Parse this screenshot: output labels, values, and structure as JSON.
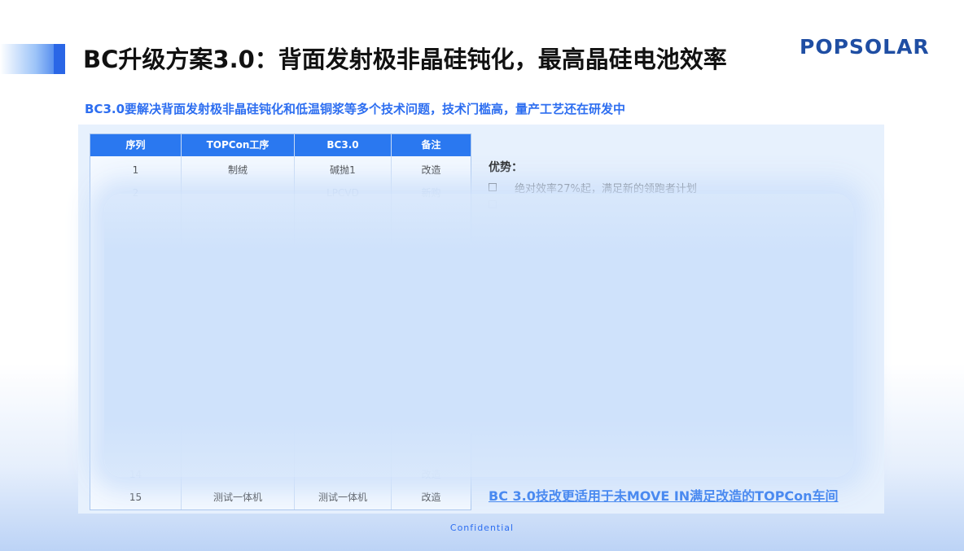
{
  "title": "BC升级方案3.0：背面发射极非晶硅钝化，最高晶硅电池效率",
  "logo": "POPSOLAR",
  "subtitle": "BC3.0要解决背面发射极非晶硅钝化和低温铜浆等多个技术问题，技术门槛高，量产工艺还在研发中",
  "table": {
    "headers": [
      "序列",
      "TOPCon工序",
      "BC3.0",
      "备注"
    ],
    "rows": [
      [
        "1",
        "制绒",
        "碱抛1",
        "改造"
      ],
      [
        "2",
        "",
        "LPCVD",
        "新购"
      ],
      [
        "14",
        "",
        "",
        "改造"
      ],
      [
        "15",
        "测试一体机",
        "测试一体机",
        "改造"
      ]
    ]
  },
  "advantages": {
    "title": "优势：",
    "items": [
      "绝对效率27%起，满足新的领跑者计划"
    ]
  },
  "conclusion": "BC 3.0技改更适用于未MOVE IN满足改造的TOPCon车间",
  "footer": "Confidential"
}
